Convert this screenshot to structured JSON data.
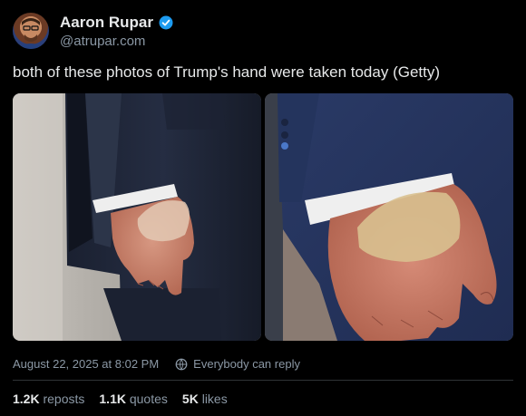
{
  "author": {
    "display_name": "Aaron Rupar",
    "handle": "@atrupar.com"
  },
  "post": {
    "text": "both of these photos of Trump's hand were taken today (Getty)",
    "timestamp": "August 22, 2025 at 8:02 PM",
    "reply_setting": "Everybody can reply"
  },
  "stats": {
    "reposts_count": "1.2K",
    "reposts_label": "reposts",
    "quotes_count": "1.1K",
    "quotes_label": "quotes",
    "likes_count": "5K",
    "likes_label": "likes"
  },
  "icons": {
    "verified": "verified-badge-icon",
    "reply_setting": "globe-icon"
  },
  "colors": {
    "background": "#000000",
    "text_primary": "#e7e9ea",
    "text_secondary": "#8b98a5",
    "verified_blue": "#1d9bf0"
  }
}
